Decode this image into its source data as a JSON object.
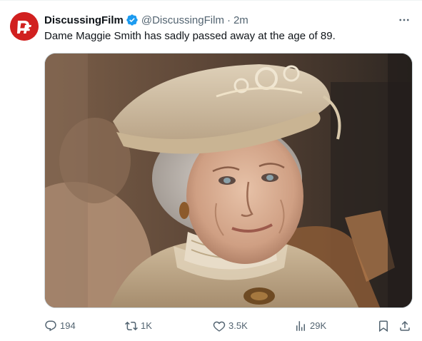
{
  "tweet": {
    "display_name": "DiscussingFilm",
    "handle": "@DiscussingFilm",
    "separator": "·",
    "time": "2m",
    "text": "Dame Maggie Smith has sadly passed away at the age of 89.",
    "verified_color": "#1d9bf0",
    "avatar_color": "#d1201f"
  },
  "icons": {
    "more": "more-horizontal-icon",
    "reply": "reply-icon",
    "retweet": "retweet-icon",
    "like": "like-icon",
    "views": "views-icon",
    "bookmark": "bookmark-icon",
    "share": "share-icon",
    "verified": "verified-badge-icon"
  },
  "actions": {
    "replies": "194",
    "retweets": "1K",
    "likes": "3.5K",
    "views": "29K"
  }
}
